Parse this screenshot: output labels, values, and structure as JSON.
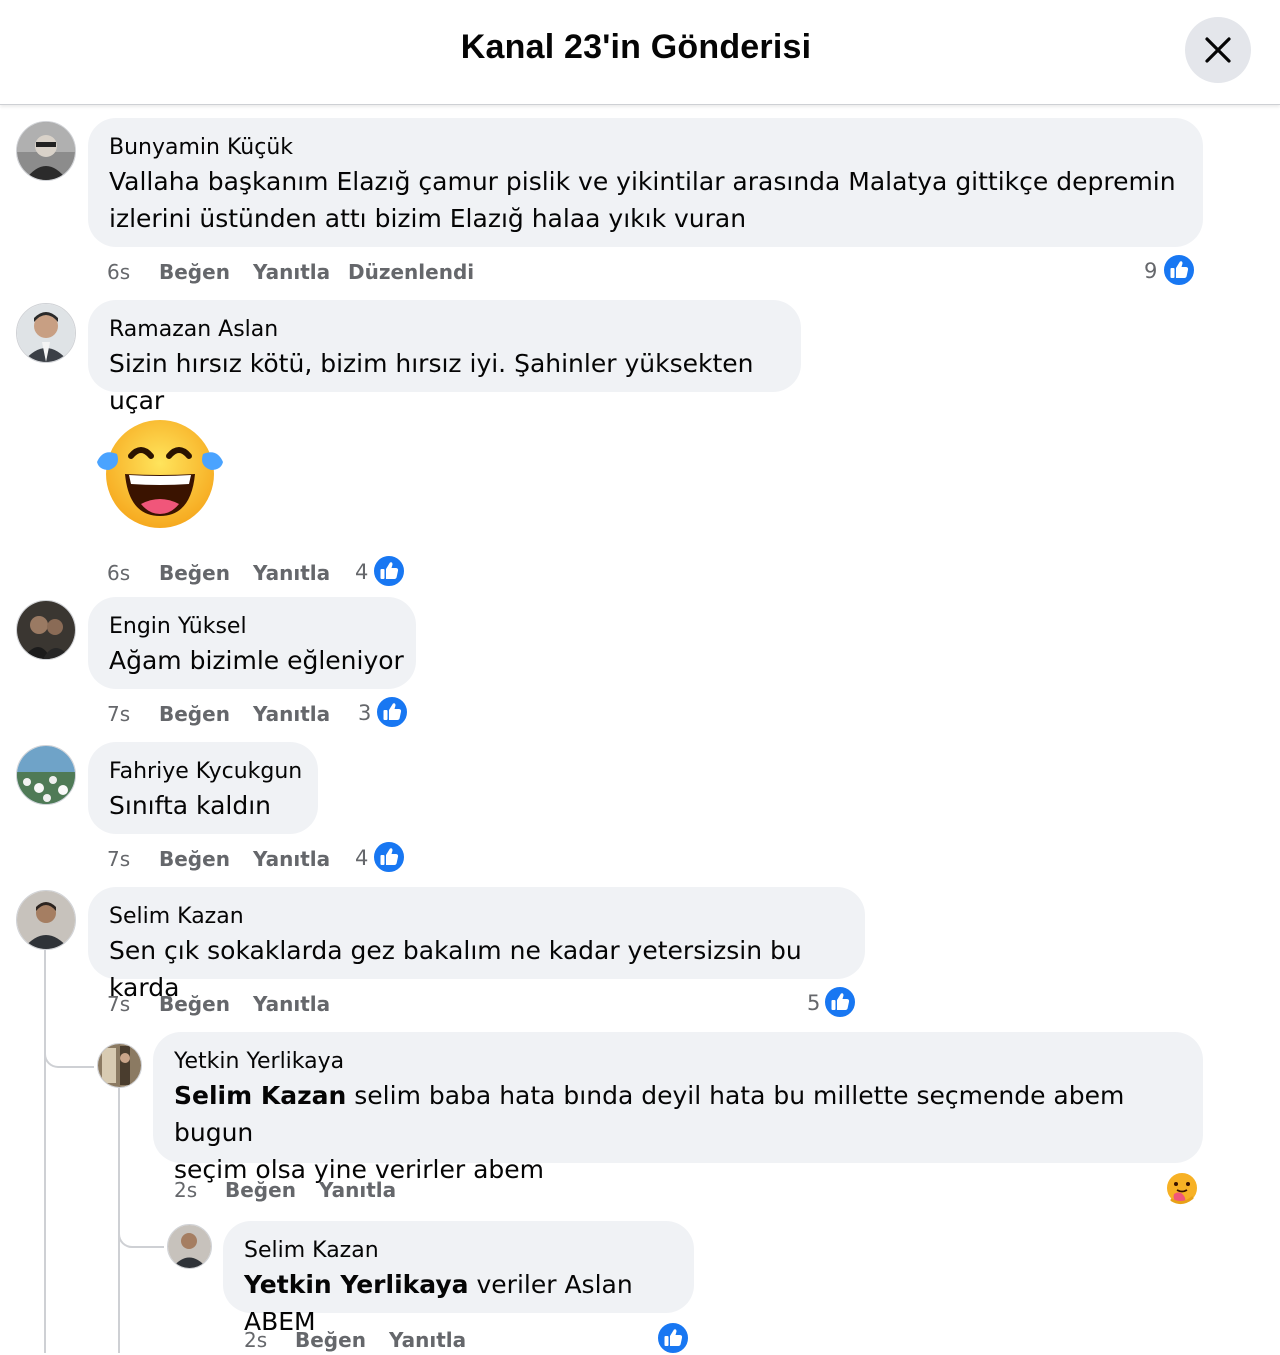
{
  "header": {
    "title": "Kanal 23'in Gönderisi"
  },
  "comments": [
    {
      "author": "Bunyamin Küçük",
      "text": "Vallaha başkanım Elazığ çamur pislik ve yikintilar arasında Malatya gittikçe depremin\nizlerini üstünden attı bizim Elazığ halaa yıkık vuran",
      "time": "6s",
      "like_label": "Beğen",
      "reply_label": "Yanıtla",
      "edited_label": "Düzenlendi",
      "reaction_count": "9"
    },
    {
      "author": "Ramazan Aslan",
      "text": "Sizin hırsız kötü, bizim hırsız iyi. Şahinler yüksekten uçar",
      "sticker": "laughing-tears-emoji",
      "time": "6s",
      "like_label": "Beğen",
      "reply_label": "Yanıtla",
      "reaction_count": "4"
    },
    {
      "author": "Engin Yüksel",
      "text": "Ağam bizimle eğleniyor",
      "time": "7s",
      "like_label": "Beğen",
      "reply_label": "Yanıtla",
      "reaction_count": "3"
    },
    {
      "author": "Fahriye Kycukgun",
      "text": "Sınıfta kaldın",
      "time": "7s",
      "like_label": "Beğen",
      "reply_label": "Yanıtla",
      "reaction_count": "4"
    },
    {
      "author": "Selim Kazan",
      "text": "Sen çık sokaklarda gez bakalım ne kadar yetersizsin bu karda",
      "time": "7s",
      "like_label": "Beğen",
      "reply_label": "Yanıtla",
      "reaction_count": "5",
      "replies": [
        {
          "author": "Yetkin Yerlikaya",
          "mention": "Selim Kazan",
          "text": " selim baba hata bında deyil hata bu millette seçmende abem bugun\nseçim olsa yine verirler abem",
          "time": "2s",
          "like_label": "Beğen",
          "reply_label": "Yanıtla",
          "reaction": "care-emoji"
        },
        {
          "author": "Selim Kazan",
          "mention": "Yetkin Yerlikaya",
          "text": " veriler Aslan ABEM",
          "time": "2s",
          "like_label": "Beğen",
          "reply_label": "Yanıtla",
          "reaction": "like"
        }
      ]
    }
  ],
  "colors": {
    "like_blue": "#1877f2",
    "bubble": "#f0f2f5",
    "meta_text": "#65676b"
  }
}
